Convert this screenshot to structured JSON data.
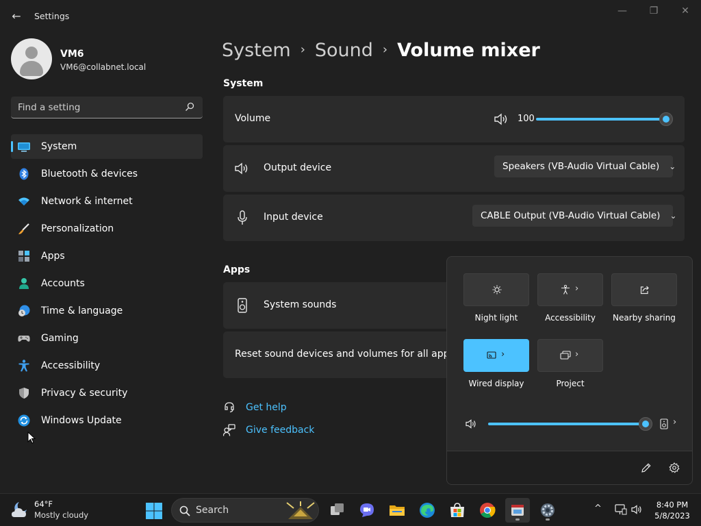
{
  "window": {
    "back_glyph": "←",
    "title": "Settings",
    "minimize_glyph": "—",
    "maximize_glyph": "❐",
    "close_glyph": "✕"
  },
  "profile": {
    "name": "VM6",
    "email": "VM6@collabnet.local"
  },
  "search": {
    "placeholder": "Find a setting"
  },
  "sidebar": {
    "items": [
      {
        "label": "System",
        "icon": "system-icon",
        "active": true
      },
      {
        "label": "Bluetooth & devices",
        "icon": "bluetooth-icon"
      },
      {
        "label": "Network & internet",
        "icon": "wifi-icon"
      },
      {
        "label": "Personalization",
        "icon": "brush-icon"
      },
      {
        "label": "Apps",
        "icon": "apps-icon"
      },
      {
        "label": "Accounts",
        "icon": "accounts-icon"
      },
      {
        "label": "Time & language",
        "icon": "clock-globe-icon"
      },
      {
        "label": "Gaming",
        "icon": "gamepad-icon"
      },
      {
        "label": "Accessibility",
        "icon": "accessibility-icon"
      },
      {
        "label": "Privacy & security",
        "icon": "shield-icon"
      },
      {
        "label": "Windows Update",
        "icon": "update-icon"
      }
    ]
  },
  "breadcrumb": {
    "items": [
      "System",
      "Sound",
      "Volume mixer"
    ],
    "separator": "›"
  },
  "main": {
    "system_section": "System",
    "volume": {
      "label": "Volume",
      "value": "100",
      "level": 1.0
    },
    "output": {
      "label": "Output device",
      "selected": "Speakers (VB-Audio Virtual Cable)"
    },
    "input": {
      "label": "Input device",
      "selected": "CABLE Output (VB-Audio Virtual Cable)"
    },
    "apps_section": "Apps",
    "system_sounds": "System sounds",
    "reset_text": "Reset sound devices and volumes for all apps to th",
    "links": {
      "help": "Get help",
      "feedback": "Give feedback"
    },
    "dropdown_chevron": "⌄"
  },
  "quick_settings": {
    "tiles": [
      {
        "label": "Night light",
        "icon": "brightness-icon",
        "on": false,
        "expand": false
      },
      {
        "label": "Accessibility",
        "icon": "accessibility-icon",
        "on": false,
        "expand": true
      },
      {
        "label": "Nearby sharing",
        "icon": "share-icon",
        "on": false,
        "expand": false
      },
      {
        "label": "Wired display",
        "icon": "cast-icon",
        "on": true,
        "expand": true
      },
      {
        "label": "Project",
        "icon": "project-icon",
        "on": false,
        "expand": true
      }
    ],
    "chevron": "›",
    "volume_level": 1.0
  },
  "taskbar": {
    "weather": {
      "temp": "64°F",
      "desc": "Mostly cloudy"
    },
    "search_label": "Search",
    "clock": {
      "time": "8:40 PM",
      "date": "5/8/2023"
    },
    "tray_chevron": "^"
  },
  "colors": {
    "accent": "#4cc2ff",
    "background": "#202020",
    "card": "#2b2b2b"
  }
}
